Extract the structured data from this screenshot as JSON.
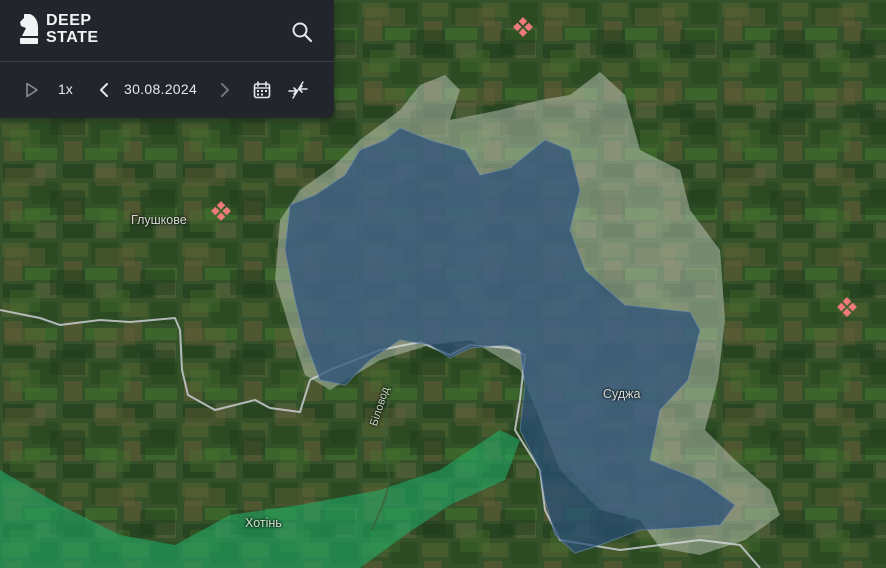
{
  "app": {
    "logo_line1": "DEEP",
    "logo_line2": "STATE"
  },
  "toolbar": {
    "speed_label": "1x",
    "date_value": "30.08.2024"
  },
  "map": {
    "labels": {
      "glushkove": "Глушкове",
      "sudzha": "Суджа",
      "khotin": "Хотінь",
      "river": "Біловод"
    },
    "colors": {
      "occupied_fill": "#2a4f7a",
      "contested_fill": "#d9e1d6",
      "green_zone": "#1fb36b",
      "border_line": "#c9cdd2",
      "marker": "#f07a7a"
    }
  },
  "icons": {
    "search": "search-icon",
    "play": "play-icon",
    "prev": "chevron-left-icon",
    "next": "chevron-right-icon",
    "calendar": "calendar-icon",
    "compare": "compare-icon",
    "logo": "knight-chess-piece-icon",
    "marker": "diamond-grid-marker-icon"
  }
}
